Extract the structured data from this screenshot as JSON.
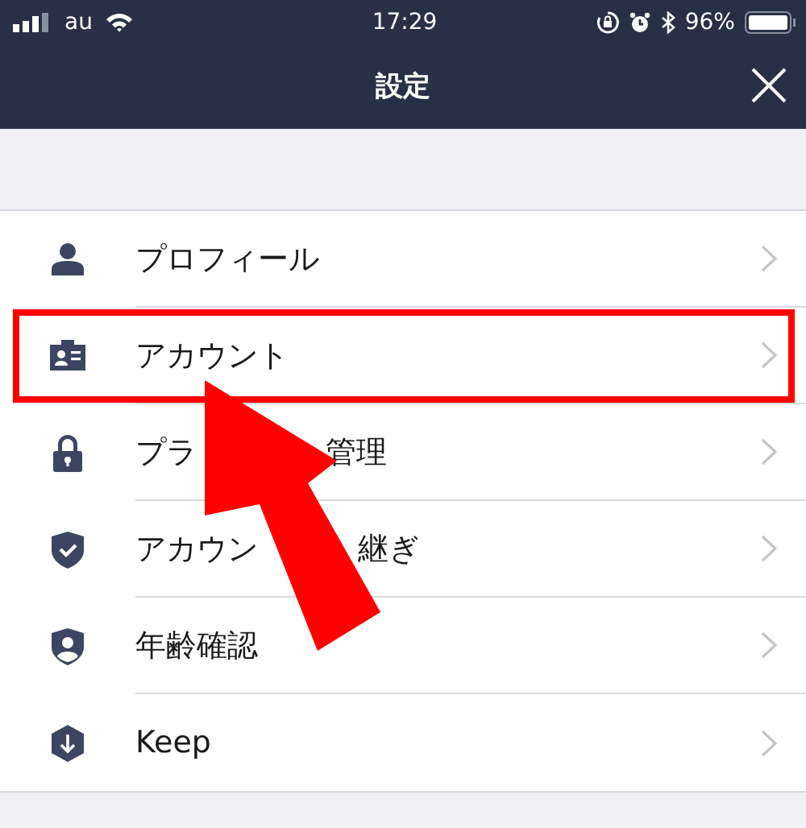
{
  "status_bar": {
    "carrier": "au",
    "time": "17:29",
    "battery": "96%"
  },
  "nav": {
    "title": "設定"
  },
  "items": [
    {
      "label_parts": [
        "プロフィール"
      ],
      "highlighted": false
    },
    {
      "label_parts": [
        "アカウント"
      ],
      "highlighted": true
    },
    {
      "label_parts": [
        "プラ",
        "管理"
      ],
      "highlighted": false
    },
    {
      "label_parts": [
        "アカウン",
        "継ぎ"
      ],
      "highlighted": false
    },
    {
      "label_parts": [
        "年齢確認"
      ],
      "highlighted": false
    },
    {
      "label_parts": [
        "Keep"
      ],
      "highlighted": false
    }
  ],
  "annotation": {
    "kind": "arrow"
  }
}
